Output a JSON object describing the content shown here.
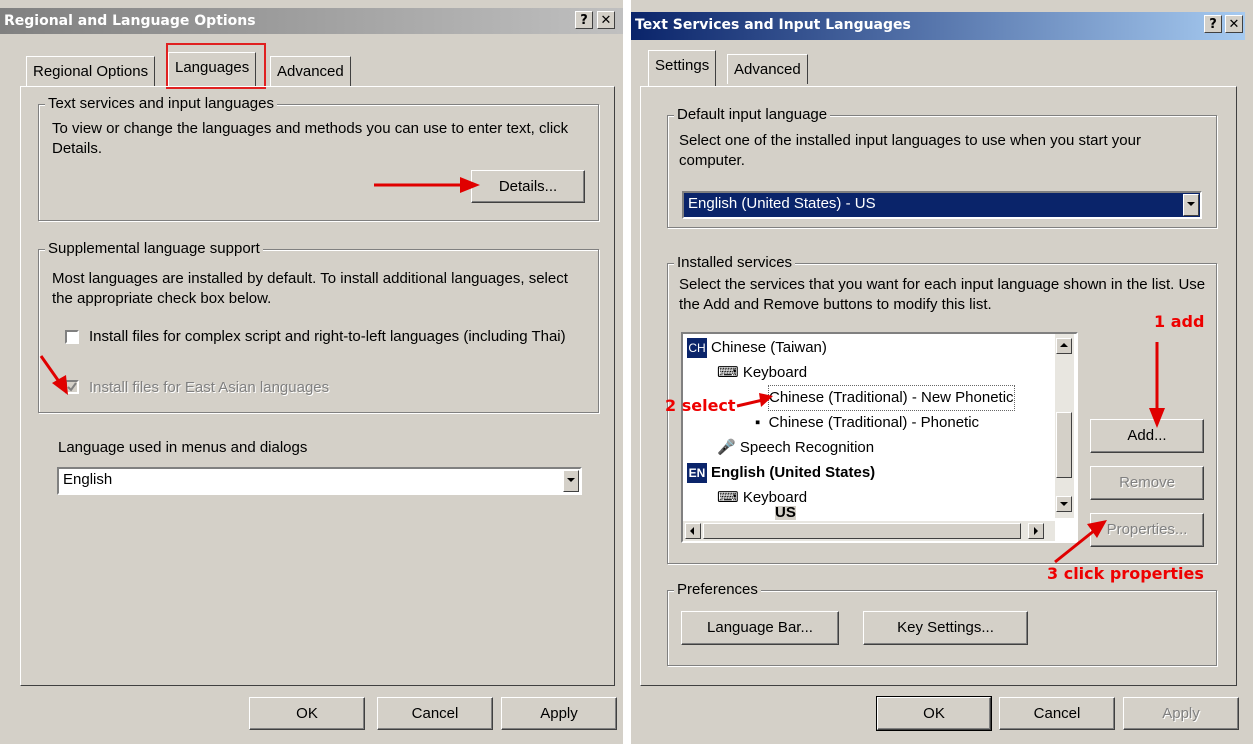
{
  "left_window": {
    "title": "Regional and Language Options",
    "tabs": [
      "Regional Options",
      "Languages",
      "Advanced"
    ],
    "group1": {
      "label": "Text services and input languages",
      "desc": "To view or change the languages and methods you can use to enter text, click Details.",
      "details_button": "Details..."
    },
    "group2": {
      "label": "Supplemental language support",
      "desc": "Most languages are installed by default. To install additional languages, select the appropriate check box below.",
      "check1": "Install files for complex script and right-to-left languages (including Thai)",
      "check2": "Install files for East Asian languages"
    },
    "menu_lang_label": "Language used in menus and dialogs",
    "menu_lang_value": "English",
    "buttons": {
      "ok": "OK",
      "cancel": "Cancel",
      "apply": "Apply"
    }
  },
  "right_window": {
    "title": "Text Services and Input Languages",
    "tabs": [
      "Settings",
      "Advanced"
    ],
    "default_group": {
      "label": "Default input language",
      "desc": "Select one of the installed input languages to use when you start your computer.",
      "value": "English (United States) - US"
    },
    "installed_group": {
      "label": "Installed services",
      "desc": "Select the services that you want for each input language shown in the list. Use the Add and Remove buttons to modify this list.",
      "items": [
        {
          "badge": "CH",
          "text": "Chinese (Taiwan)"
        },
        {
          "text": "Keyboard"
        },
        {
          "text": "Chinese (Traditional) - New Phonetic"
        },
        {
          "text": "Chinese (Traditional) - Phonetic"
        },
        {
          "text": "Speech Recognition"
        },
        {
          "badge": "EN",
          "text": "English (United States)"
        },
        {
          "text": "Keyboard"
        },
        {
          "text": "US"
        }
      ],
      "add": "Add...",
      "remove": "Remove",
      "properties": "Properties..."
    },
    "preferences": {
      "label": "Preferences",
      "language_bar": "Language Bar...",
      "key_settings": "Key Settings..."
    },
    "buttons": {
      "ok": "OK",
      "cancel": "Cancel",
      "apply": "Apply"
    }
  },
  "annotations": {
    "add": "1 add",
    "select": "2 select",
    "props": "3 click properties"
  },
  "colors": {
    "left_title": "#a0a0a0",
    "right_title": "#0a246a",
    "annotation": "#ee0000",
    "selection": "#0a246a"
  }
}
